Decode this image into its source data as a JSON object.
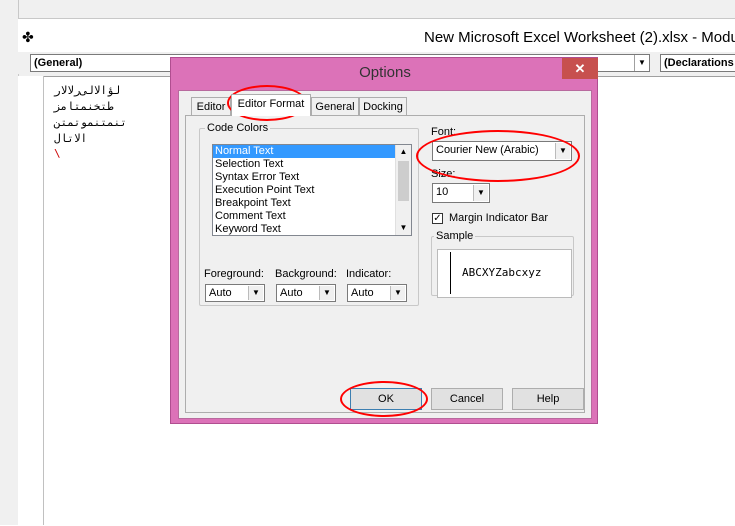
{
  "window": {
    "title": "New Microsoft Excel Worksheet (2).xlsx - Modu",
    "object_combo": "(General)",
    "proc_combo": "(Declarations"
  },
  "code": {
    "lines": [
      "لؤ‌الالی‌رلالار",
      "طتخنمتامز",
      "تنمتنموتمتن",
      "الاتال",
      "\\"
    ]
  },
  "dialog": {
    "title": "Options",
    "close": "✕",
    "tabs": [
      "Editor",
      "Editor Format",
      "General",
      "Docking"
    ],
    "selected_tab": "Editor Format",
    "code_colors_label": "Code Colors",
    "code_colors": [
      "Normal Text",
      "Selection Text",
      "Syntax Error Text",
      "Execution Point Text",
      "Breakpoint Text",
      "Comment Text",
      "Keyword Text"
    ],
    "selected_code_color": "Normal Text",
    "foreground_label": "Foreground:",
    "background_label": "Background:",
    "indicator_label": "Indicator:",
    "foreground_value": "Auto",
    "background_value": "Auto",
    "indicator_value": "Auto",
    "font_label": "Font:",
    "font_value": "Courier New (Arabic)",
    "size_label": "Size:",
    "size_value": "10",
    "margin_label": "Margin Indicator Bar",
    "margin_checked": true,
    "sample_label": "Sample",
    "sample_text": "ABCXYZabcxyz",
    "ok": "OK",
    "cancel": "Cancel",
    "help": "Help"
  },
  "colors": {
    "dialog_frame": "#dc72b8",
    "close_button": "#c7504e",
    "selection": "#3399ff",
    "annotation": "#ff0000",
    "code_red": "#cc0000"
  }
}
